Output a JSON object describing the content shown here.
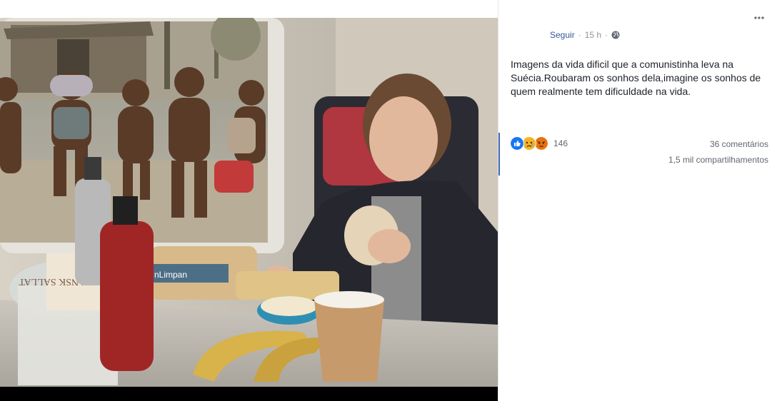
{
  "post": {
    "follow_label": "Seguir",
    "separator": "·",
    "time": "15 h",
    "privacy_icon": "globe-icon",
    "more_icon": "more-options-icon",
    "text": "Imagens da vida dificil que a comunistinha leva na Suécia.Roubaram os sonhos dela,imagine os sonhos de quem realmente tem dificuldade na vida."
  },
  "reactions": {
    "icons": [
      "like-icon",
      "sad-icon",
      "angry-icon"
    ],
    "count": "146"
  },
  "stats": {
    "comments": "36 comentários",
    "shares": "1,5 mil compartilhamentos"
  },
  "photo": {
    "packaging_text_1": "VEGANSK SALLAT",
    "packaging_text_2": "nLimpan"
  },
  "colors": {
    "link": "#365899",
    "meta": "#90949c",
    "text": "#1d2129",
    "like": "#1877f2",
    "sad": "#f7b125",
    "angry": "#e9710f"
  }
}
